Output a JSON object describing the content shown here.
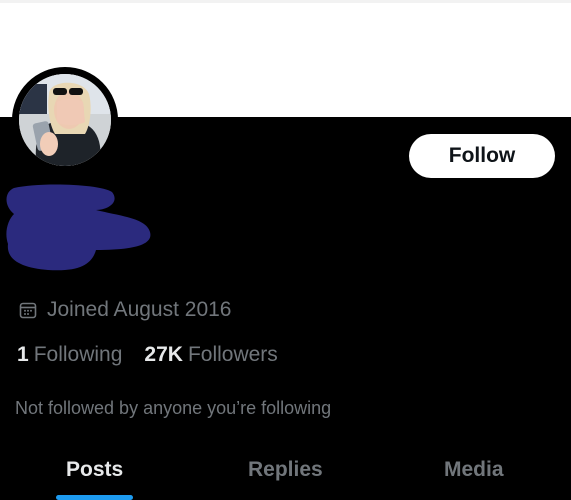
{
  "profile": {
    "follow_label": "Follow",
    "joined_text": "Joined August 2016",
    "following_count": "1",
    "following_label": "Following",
    "followers_count": "27K",
    "followers_label": "Followers",
    "not_followed_text": "Not followed by anyone you’re following"
  },
  "tabs": [
    {
      "label": "Posts",
      "active": true
    },
    {
      "label": "Replies",
      "active": false
    },
    {
      "label": "Media",
      "active": false
    }
  ],
  "colors": {
    "background": "#000000",
    "muted_text": "#71767b",
    "primary_text": "#e7e9ea",
    "accent": "#1d9bf0",
    "redaction": "#2b2a7e"
  },
  "icons": {
    "joined": "calendar-icon"
  }
}
